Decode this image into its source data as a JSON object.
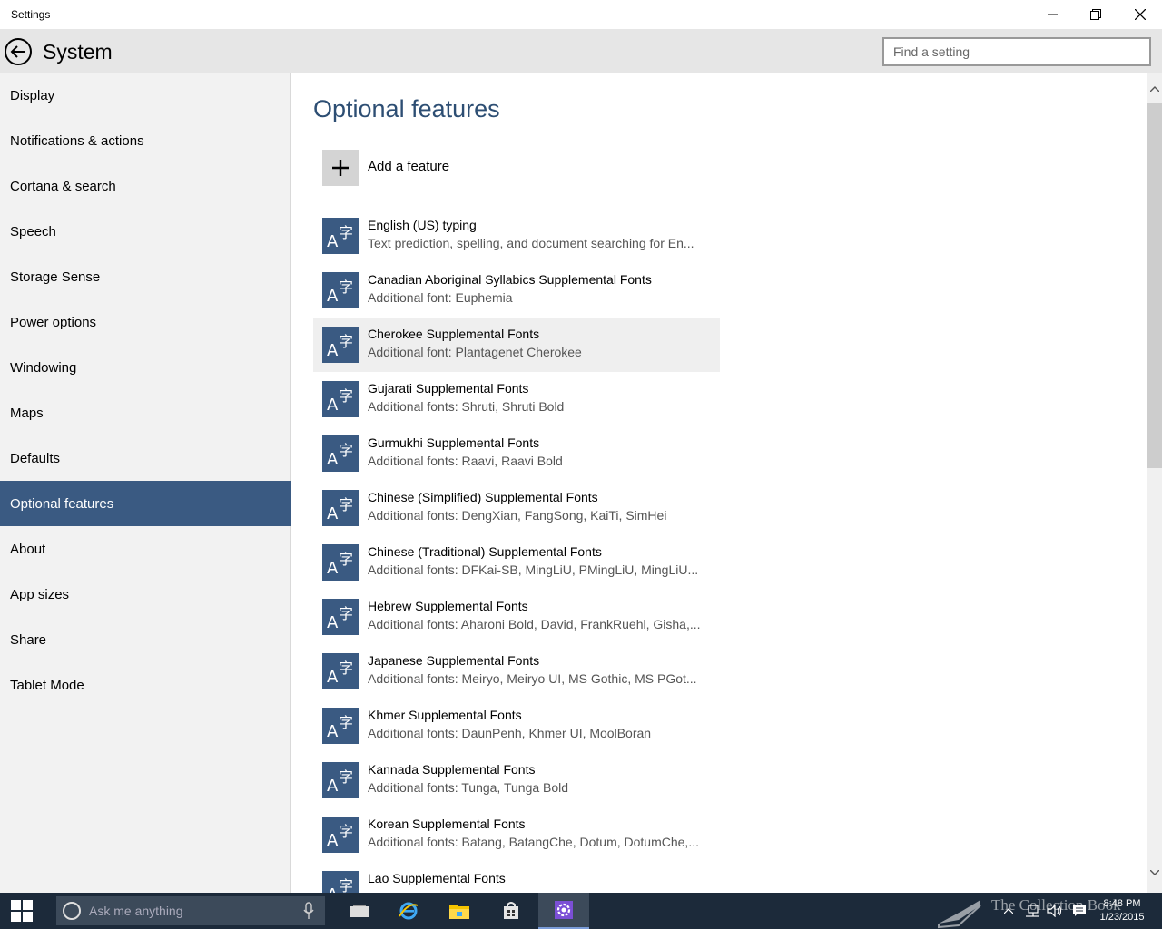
{
  "window": {
    "title": "Settings"
  },
  "header": {
    "section_title": "System",
    "search_placeholder": "Find a setting"
  },
  "sidebar": {
    "items": [
      {
        "label": "Display"
      },
      {
        "label": "Notifications & actions"
      },
      {
        "label": "Cortana & search"
      },
      {
        "label": "Speech"
      },
      {
        "label": "Storage Sense"
      },
      {
        "label": "Power options"
      },
      {
        "label": "Windowing"
      },
      {
        "label": "Maps"
      },
      {
        "label": "Defaults"
      },
      {
        "label": "Optional features",
        "selected": true
      },
      {
        "label": "About"
      },
      {
        "label": "App sizes"
      },
      {
        "label": "Share"
      },
      {
        "label": "Tablet Mode"
      }
    ]
  },
  "main": {
    "title": "Optional features",
    "add_feature_label": "Add a feature",
    "features": [
      {
        "name": "English (US) typing",
        "desc": "Text prediction, spelling, and document searching for En..."
      },
      {
        "name": "Canadian Aboriginal Syllabics Supplemental Fonts",
        "desc": "Additional font: Euphemia"
      },
      {
        "name": "Cherokee Supplemental Fonts",
        "desc": "Additional font: Plantagenet Cherokee",
        "hover": true
      },
      {
        "name": "Gujarati Supplemental Fonts",
        "desc": "Additional fonts: Shruti, Shruti Bold"
      },
      {
        "name": "Gurmukhi Supplemental Fonts",
        "desc": "Additional fonts: Raavi, Raavi Bold"
      },
      {
        "name": "Chinese (Simplified) Supplemental Fonts",
        "desc": "Additional fonts: DengXian, FangSong, KaiTi, SimHei"
      },
      {
        "name": "Chinese (Traditional) Supplemental Fonts",
        "desc": "Additional fonts: DFKai-SB, MingLiU, PMingLiU, MingLiU..."
      },
      {
        "name": "Hebrew Supplemental Fonts",
        "desc": "Additional fonts: Aharoni Bold, David, FrankRuehl, Gisha,..."
      },
      {
        "name": "Japanese Supplemental Fonts",
        "desc": "Additional fonts: Meiryo, Meiryo UI, MS Gothic, MS PGot..."
      },
      {
        "name": "Khmer Supplemental Fonts",
        "desc": "Additional fonts: DaunPenh, Khmer UI, MoolBoran"
      },
      {
        "name": "Kannada Supplemental Fonts",
        "desc": "Additional fonts: Tunga, Tunga Bold"
      },
      {
        "name": "Korean Supplemental Fonts",
        "desc": "Additional fonts: Batang, BatangChe, Dotum, DotumChe,..."
      },
      {
        "name": "Lao Supplemental Fonts",
        "desc": ""
      }
    ],
    "feature_icon_glyph_a": "A",
    "feature_icon_glyph_z": "字"
  },
  "taskbar": {
    "search_placeholder": "Ask me anything",
    "time": "8:48 PM",
    "date": "1/23/2015",
    "watermark": "The Collection Book"
  },
  "icons": {
    "back": "back-arrow-icon",
    "minimize": "minimize-icon",
    "maximize": "restore-icon",
    "close": "close-icon",
    "add": "plus-icon",
    "feature": "language-font-icon"
  },
  "colors": {
    "accent": "#3a5a82",
    "title_text": "#2d4e73",
    "header_bg": "#e6e6e6",
    "sidebar_bg": "#f2f2f2",
    "taskbar_bg": "#1c2a3a"
  }
}
